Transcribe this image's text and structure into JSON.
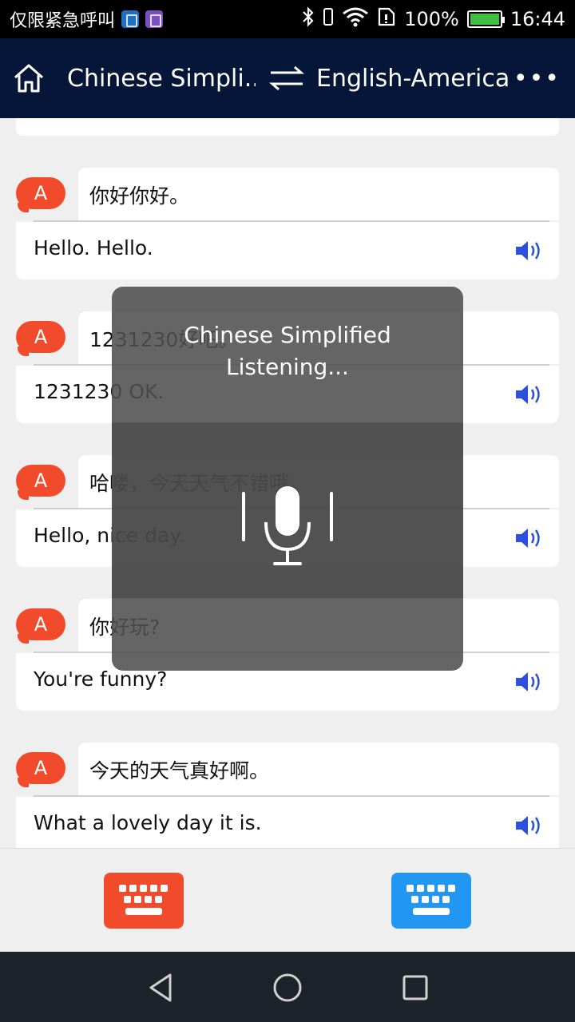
{
  "status_bar": {
    "carrier": "仅限紧急呼叫",
    "battery": "100%",
    "time": "16:44",
    "icons": [
      "usb-icon",
      "image-icon",
      "bluetooth-icon",
      "vibrate-icon",
      "wifi-icon",
      "sim-icon",
      "battery-icon"
    ]
  },
  "header": {
    "source_lang": "Chinese Simpli...",
    "target_lang": "English-America",
    "more": "•••",
    "icons": [
      "home-icon",
      "swap-icon",
      "more-icon"
    ]
  },
  "conversation": [
    {
      "avatar": "A",
      "source": "你好你好。",
      "target": "Hello. Hello."
    },
    {
      "avatar": "A",
      "source": "1231230好吧。",
      "target": "1231230 OK."
    },
    {
      "avatar": "A",
      "source": "哈喽，今天天气不错哦。",
      "target": "Hello, nice day."
    },
    {
      "avatar": "A",
      "source": "你好玩?",
      "target": "You're funny?"
    },
    {
      "avatar": "A",
      "source": "今天的天气真好啊。",
      "target": "What a lovely day it is."
    }
  ],
  "overlay": {
    "language": "Chinese Simplified",
    "status": "Listening..."
  },
  "colors": {
    "header_bg": "#061638",
    "accent_red": "#f24b2c",
    "accent_blue": "#2196f3",
    "speaker_blue": "#2d4fe0"
  }
}
